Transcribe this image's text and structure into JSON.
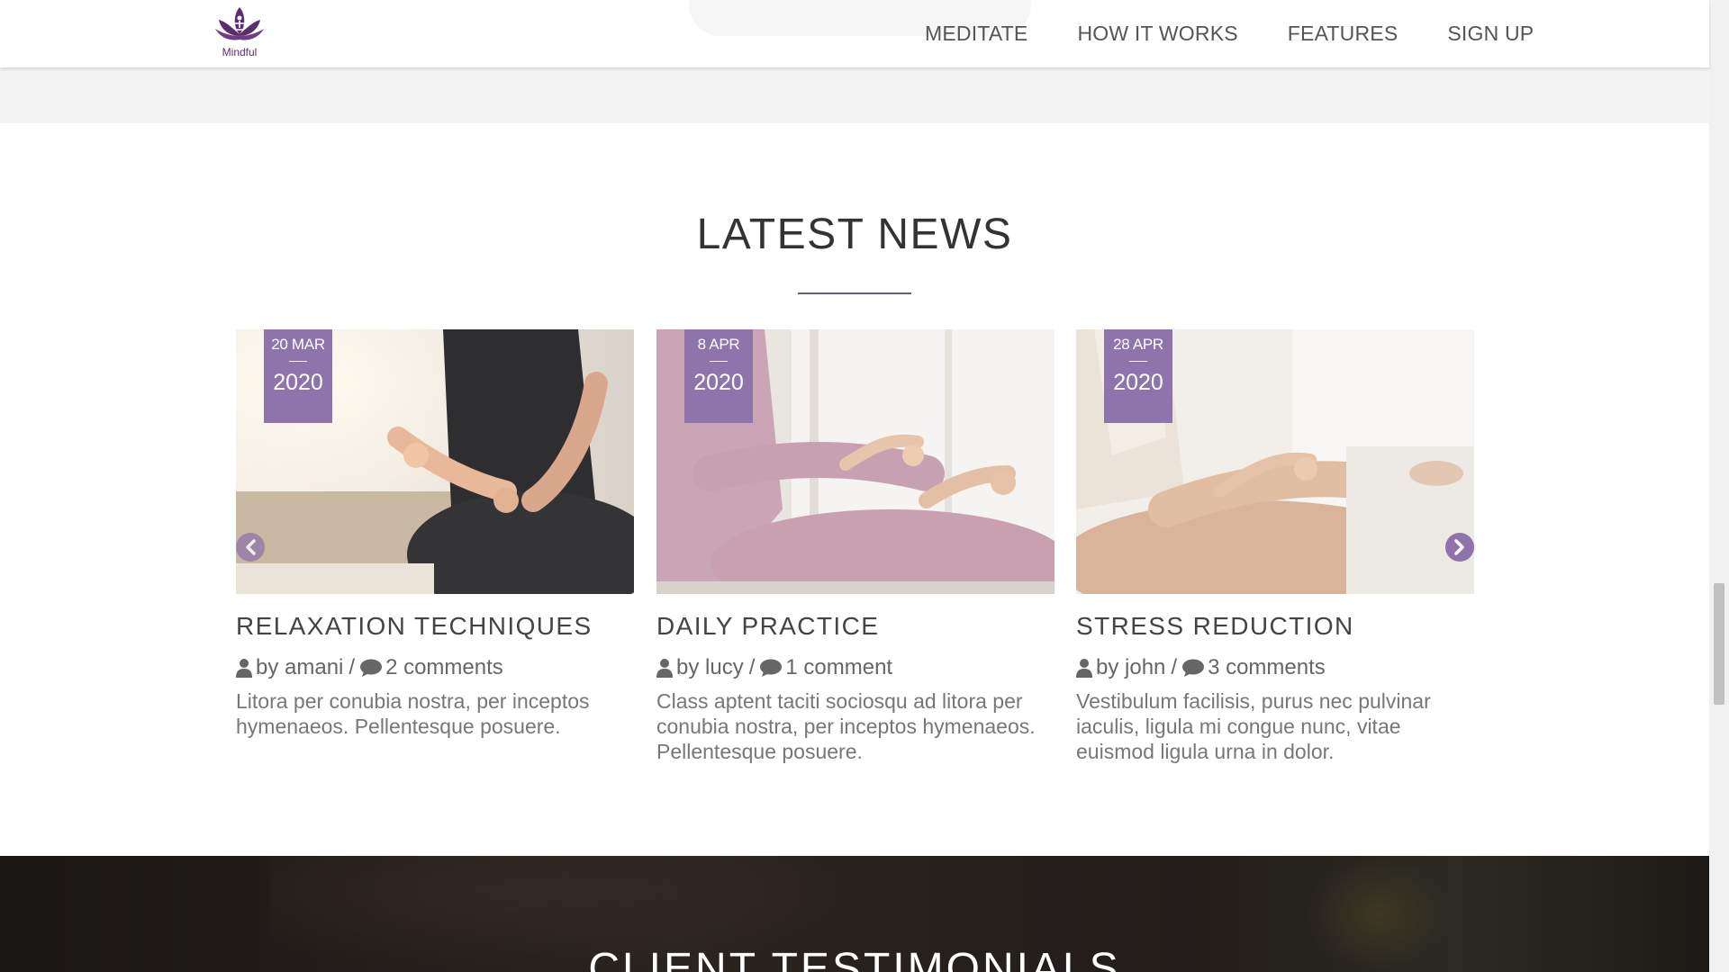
{
  "header": {
    "logo_text": "Mindful",
    "nav": [
      "MEDITATE",
      "HOW IT WORKS",
      "FEATURES",
      "SIGN UP"
    ]
  },
  "latest_news": {
    "title": "LATEST NEWS",
    "cards": [
      {
        "date_day": "20 MAR",
        "date_year": "2020",
        "title": "RELAXATION TECHNIQUES",
        "author": "by amani",
        "separator": "/",
        "comments": "2 comments",
        "text": "Litora per conubia nostra, per inceptos hymenaeos. Pellentesque posuere."
      },
      {
        "date_day": "8 APR",
        "date_year": "2020",
        "title": "DAILY PRACTICE",
        "author": "by lucy",
        "separator": "/",
        "comments": "1 comment",
        "text": "Class aptent taciti sociosqu ad litora per conubia nostra, per inceptos hymenaeos. Pellentesque posuere."
      },
      {
        "date_day": "28 APR",
        "date_year": "2020",
        "title": "STRESS REDUCTION",
        "author": "by john",
        "separator": "/",
        "comments": "3 comments",
        "text": "Vestibulum facilisis, purus nec pulvinar iaculis, ligula mi congue nunc, vitae euismod ligula urna in dolor."
      }
    ]
  },
  "testimonials": {
    "title": "CLIENT TESTIMONIALS"
  },
  "colors": {
    "accent": "#8f73ab",
    "brand": "#5a2d6e",
    "rule": "#6b5a85"
  }
}
